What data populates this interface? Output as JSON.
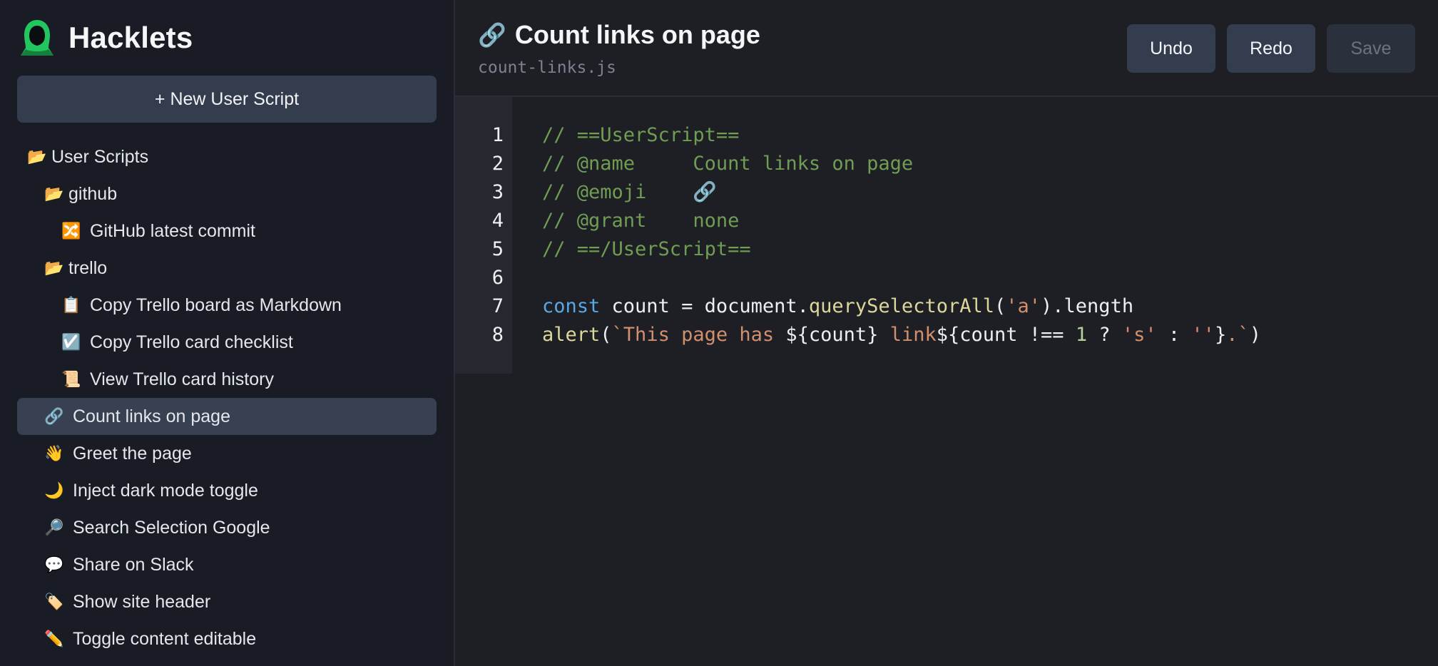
{
  "brand": {
    "name": "Hacklets",
    "logo_icon": "hooded-figure-logo",
    "accent": "#22c55e"
  },
  "sidebar": {
    "new_script_label": "+ New User Script",
    "folders": {
      "root": {
        "emoji": "📂",
        "label": "User Scripts"
      },
      "github": {
        "emoji": "📂",
        "label": "github"
      },
      "trello": {
        "emoji": "📂",
        "label": "trello"
      }
    },
    "scripts": [
      {
        "emoji": "🔀",
        "label": "GitHub latest commit"
      },
      {
        "emoji": "📋",
        "label": "Copy Trello board as Markdown"
      },
      {
        "emoji": "☑️",
        "label": "Copy Trello card checklist"
      },
      {
        "emoji": "📜",
        "label": "View Trello card history"
      },
      {
        "emoji": "🔗",
        "label": "Count links on page"
      },
      {
        "emoji": "👋",
        "label": "Greet the page"
      },
      {
        "emoji": "🌙",
        "label": "Inject dark mode toggle"
      },
      {
        "emoji": "🔎",
        "label": "Search Selection Google"
      },
      {
        "emoji": "💬",
        "label": "Share on Slack"
      },
      {
        "emoji": "🏷️",
        "label": "Show site header"
      },
      {
        "emoji": "✏️",
        "label": "Toggle content editable"
      }
    ]
  },
  "header": {
    "emoji": "🔗",
    "title": "Count links on page",
    "filename": "count-links.js",
    "undo_label": "Undo",
    "redo_label": "Redo",
    "save_label": "Save"
  },
  "editor": {
    "line_numbers": [
      "1",
      "2",
      "3",
      "4",
      "5",
      "6",
      "7",
      "8"
    ],
    "lines": [
      [
        {
          "t": "cm",
          "v": "// ==UserScript=="
        }
      ],
      [
        {
          "t": "cm",
          "v": "// @name     Count links on page"
        }
      ],
      [
        {
          "t": "cm",
          "v": "// @emoji    🔗"
        }
      ],
      [
        {
          "t": "cm",
          "v": "// @grant    none"
        }
      ],
      [
        {
          "t": "cm",
          "v": "// ==/UserScript=="
        }
      ],
      [],
      [
        {
          "t": "kw",
          "v": "const"
        },
        {
          "t": "pl",
          "v": " count = document."
        },
        {
          "t": "fn",
          "v": "querySelectorAll"
        },
        {
          "t": "pl",
          "v": "("
        },
        {
          "t": "str",
          "v": "'a'"
        },
        {
          "t": "pl",
          "v": ").length"
        }
      ],
      [
        {
          "t": "fn",
          "v": "alert"
        },
        {
          "t": "pl",
          "v": "("
        },
        {
          "t": "str",
          "v": "`This page has "
        },
        {
          "t": "pl",
          "v": "${count} "
        },
        {
          "t": "str",
          "v": "link"
        },
        {
          "t": "pl",
          "v": "${count !== "
        },
        {
          "t": "num",
          "v": "1"
        },
        {
          "t": "pl",
          "v": " ? "
        },
        {
          "t": "str",
          "v": "'s'"
        },
        {
          "t": "pl",
          "v": " : "
        },
        {
          "t": "str",
          "v": "''"
        },
        {
          "t": "pl",
          "v": "}"
        },
        {
          "t": "str",
          "v": ".`"
        },
        {
          "t": "pl",
          "v": ")"
        }
      ]
    ]
  }
}
